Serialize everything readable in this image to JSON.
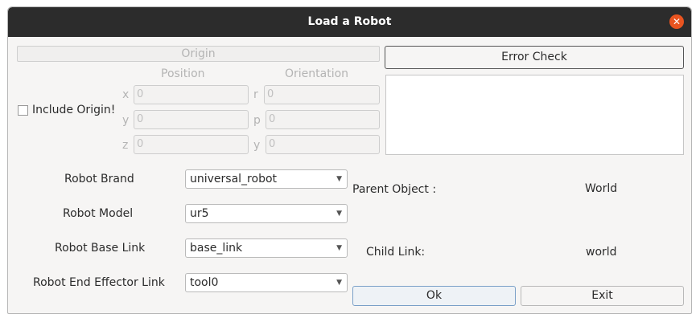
{
  "window": {
    "title": "Load a Robot"
  },
  "origin": {
    "header": "Origin",
    "position_label": "Position",
    "orientation_label": "Orientation",
    "include_label": "Include Origin!",
    "fields": [
      {
        "axis": "x",
        "value": "0"
      },
      {
        "axis": "y",
        "value": "0"
      },
      {
        "axis": "z",
        "value": "0"
      },
      {
        "axis": "r",
        "value": "0"
      },
      {
        "axis": "p",
        "value": "0"
      },
      {
        "axis": "y",
        "value": "0"
      }
    ]
  },
  "error_check": {
    "button_label": "Error Check",
    "output_text": ""
  },
  "form": {
    "brand_label": "Robot Brand",
    "brand_value": "universal_robot",
    "model_label": "Robot Model",
    "model_value": "ur5",
    "base_link_label": "Robot Base Link",
    "base_link_value": "base_link",
    "end_effector_label": "Robot End Effector Link",
    "end_effector_value": "tool0"
  },
  "relations": {
    "parent_label": "Parent Object :",
    "parent_value": "World",
    "child_label": "Child Link:",
    "child_value": "world"
  },
  "buttons": {
    "ok": "Ok",
    "exit": "Exit"
  }
}
